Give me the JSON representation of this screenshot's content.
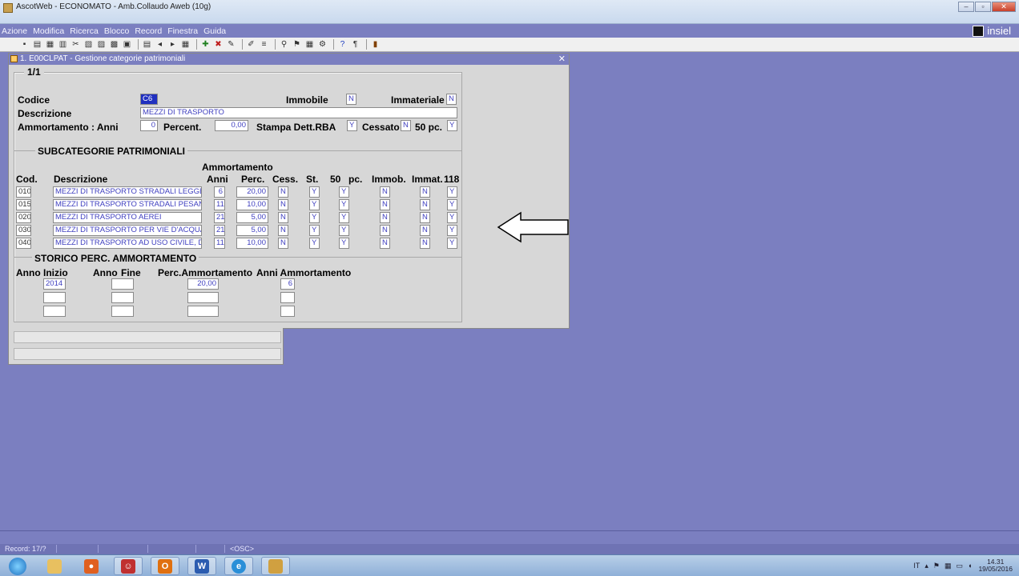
{
  "window": {
    "title": "AscotWeb - ECONOMATO - Amb.Collaudo Aweb (10g)"
  },
  "menu": [
    "Azione",
    "Modifica",
    "Ricerca",
    "Blocco",
    "Record",
    "Finestra",
    "Guida"
  ],
  "brand": "insiel",
  "form": {
    "title": "1. E00CLPAT - Gestione categorie patrimoniali",
    "frame_counter": "1/1",
    "labels": {
      "codice": "Codice",
      "descrizione": "Descrizione",
      "ammortamento_anni": "Ammortamento : Anni",
      "percent": "Percent.",
      "stampa": "Stampa Dett.RBA",
      "cessato": "Cessato",
      "pc50": "50 pc.",
      "immobile": "Immobile",
      "immateriale": "Immateriale"
    },
    "values": {
      "codice": "C6",
      "descrizione": "MEZZI DI TRASPORTO",
      "anni": "0",
      "percent": "0,00",
      "stampa": "Y",
      "cessato": "N",
      "pc50": "Y",
      "immobile": "N",
      "immateriale": "N"
    }
  },
  "subcategorie": {
    "title": "SUBCATEGORIE PATRIMONIALI",
    "group_header": "Ammortamento",
    "headers": [
      "Cod.",
      "Descrizione",
      "Anni",
      "Perc.",
      "Cess.",
      "St.",
      "50",
      "pc.",
      "Immob.",
      "Immat.",
      "118"
    ],
    "rows": [
      {
        "cod": "010",
        "desc": "MEZZI DI TRASPORTO STRADALI LEGGER",
        "anni": "6",
        "perc": "20,00",
        "cess": "N",
        "st": "Y",
        "pc50": "Y",
        "immob": "N",
        "immat": "N",
        "f118": "Y"
      },
      {
        "cod": "015",
        "desc": "MEZZI DI TRASPORTO STRADALI PESANT",
        "anni": "11",
        "perc": "10,00",
        "cess": "N",
        "st": "Y",
        "pc50": "Y",
        "immob": "N",
        "immat": "N",
        "f118": "Y"
      },
      {
        "cod": "020",
        "desc": "MEZZI DI TRASPORTO AEREI",
        "anni": "21",
        "perc": "5,00",
        "cess": "N",
        "st": "Y",
        "pc50": "Y",
        "immob": "N",
        "immat": "N",
        "f118": "Y"
      },
      {
        "cod": "030",
        "desc": "MEZZI DI TRASPORTO PER VIE D'ACQUA",
        "anni": "21",
        "perc": "5,00",
        "cess": "N",
        "st": "Y",
        "pc50": "Y",
        "immob": "N",
        "immat": "N",
        "f118": "Y"
      },
      {
        "cod": "040",
        "desc": "MEZZI DI TRASPORTO AD USO CIVILE, DI",
        "anni": "11",
        "perc": "10,00",
        "cess": "N",
        "st": "Y",
        "pc50": "Y",
        "immob": "N",
        "immat": "N",
        "f118": "Y"
      }
    ]
  },
  "storico": {
    "title": "STORICO PERC. AMMORTAMENTO",
    "headers": [
      "Anno",
      "Inizio",
      "Anno",
      "Fine",
      "Perc.Ammortamento",
      "Anni Ammortamento"
    ],
    "rows": [
      {
        "inizio": "2014",
        "fine": "",
        "perc": "20,00",
        "anni": "6"
      },
      {
        "inizio": "",
        "fine": "",
        "perc": "",
        "anni": ""
      },
      {
        "inizio": "",
        "fine": "",
        "perc": "",
        "anni": ""
      }
    ]
  },
  "status": {
    "record": "Record: 17/?",
    "osc": "<OSC>"
  },
  "tray": {
    "lang": "IT",
    "time": "14.31",
    "date": "19/05/2016"
  }
}
